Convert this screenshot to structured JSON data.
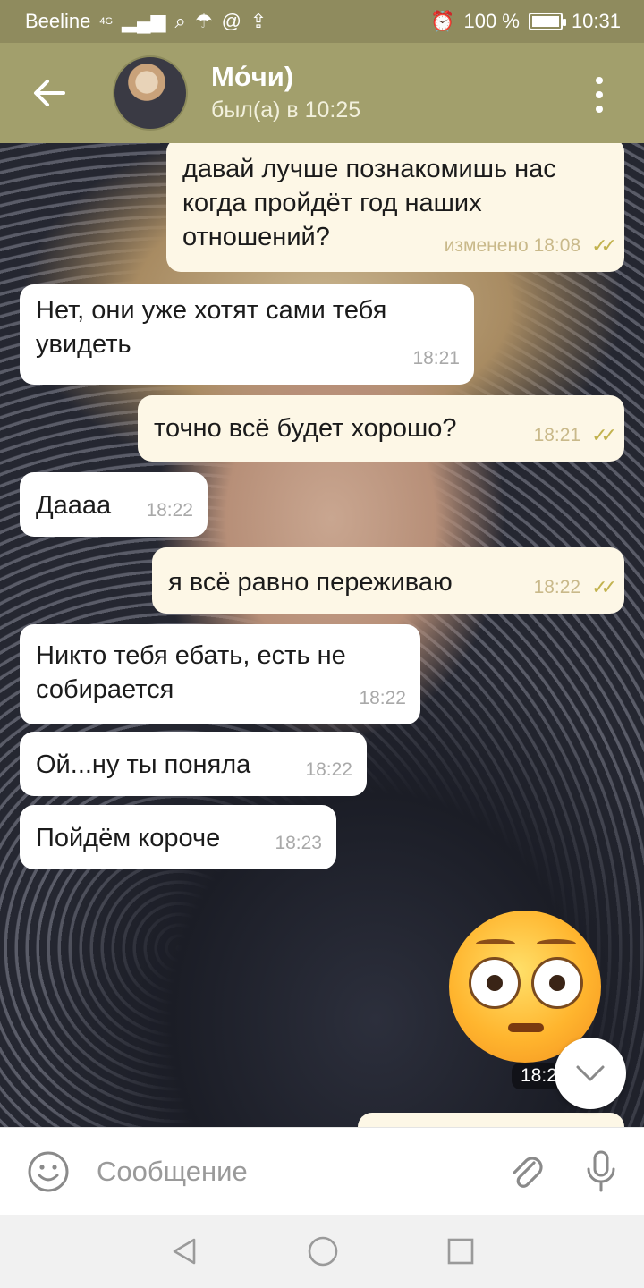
{
  "status_bar": {
    "carrier": "Beeline",
    "network": "4G",
    "battery": "100 %",
    "time": "10:31"
  },
  "header": {
    "title": "Мо́чи)",
    "status": "был(а) в 10:25"
  },
  "messages": [
    {
      "direction": "out",
      "text": "давай лучше познакомишь нас когда пройдёт год наших отношений?",
      "time": "изменено 18:08"
    },
    {
      "direction": "in",
      "text": "Нет, они уже хотят сами тебя увидеть",
      "time": "18:21"
    },
    {
      "direction": "out",
      "text": "точно всё будет хорошо?",
      "time": "18:21"
    },
    {
      "direction": "in",
      "text": "Даааа",
      "time": "18:22"
    },
    {
      "direction": "out",
      "text": "я всё равно переживаю",
      "time": "18:22"
    },
    {
      "direction": "in",
      "text": "Никто тебя ебать, есть не собирается",
      "time": "18:22"
    },
    {
      "direction": "in",
      "text": "Ой...ну ты поняла",
      "time": "18:22"
    },
    {
      "direction": "in",
      "text": "Пойдём короче",
      "time": "18:23"
    }
  ],
  "sticker": {
    "icon": "flushed-face-sticker",
    "time": "18:2"
  },
  "input": {
    "placeholder": "Сообщение"
  },
  "colors": {
    "header": "#a29f6c",
    "status_bar": "#8f8b5e",
    "outgoing_bubble": "#fdf7e6",
    "incoming_bubble": "#ffffff",
    "read_ticks": "#c2b24e"
  }
}
